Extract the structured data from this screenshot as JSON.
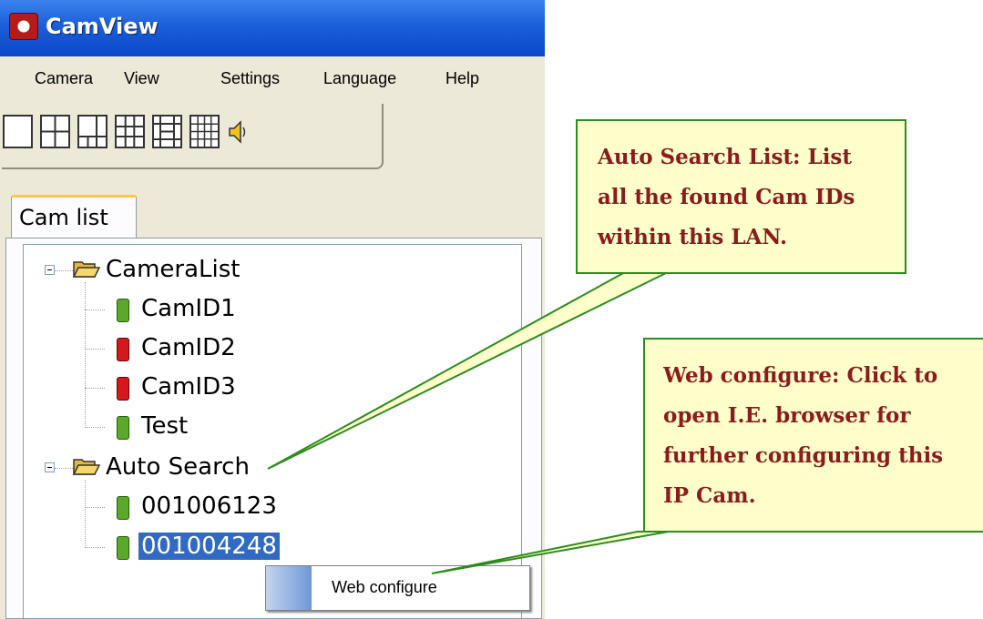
{
  "window": {
    "title": "CamView"
  },
  "menu": {
    "items": [
      "Camera",
      "View",
      "Settings",
      "Language",
      "Help"
    ]
  },
  "toolbar": {
    "buttons": [
      "layout-1-icon",
      "layout-4-icon",
      "layout-6-icon",
      "layout-9-icon",
      "layout-13-icon",
      "layout-16-icon",
      "speaker-icon"
    ]
  },
  "tabs": {
    "cam_list": "Cam list"
  },
  "tree": {
    "camera_list": {
      "label": "CameraList",
      "items": [
        {
          "label": "CamID1",
          "status": "online",
          "color": "#5aaa2a"
        },
        {
          "label": "CamID2",
          "status": "offline",
          "color": "#d81818"
        },
        {
          "label": "CamID3",
          "status": "offline",
          "color": "#d81818"
        },
        {
          "label": "Test",
          "status": "online",
          "color": "#5aaa2a"
        }
      ]
    },
    "auto_search": {
      "label": "Auto Search",
      "items": [
        {
          "label": "001006123",
          "status": "online",
          "color": "#5aaa2a"
        },
        {
          "label": "001004248",
          "status": "online",
          "color": "#5aaa2a",
          "selected": true
        }
      ]
    }
  },
  "context_menu": {
    "items": [
      "Web configure"
    ]
  },
  "callouts": {
    "auto_search": {
      "lines": [
        "Auto Search List: List",
        "all the found Cam IDs",
        "within this LAN."
      ]
    },
    "web_configure": {
      "lines": [
        "Web configure: Click to",
        "open I.E. browser for",
        "further configuring this",
        "IP Cam."
      ]
    }
  },
  "colors": {
    "titlebar": "#0a47c9",
    "callout_fill": "#ffffcc",
    "callout_border": "#2e8b1f",
    "callout_text": "#8b1c1c",
    "selection": "#316ac5"
  }
}
